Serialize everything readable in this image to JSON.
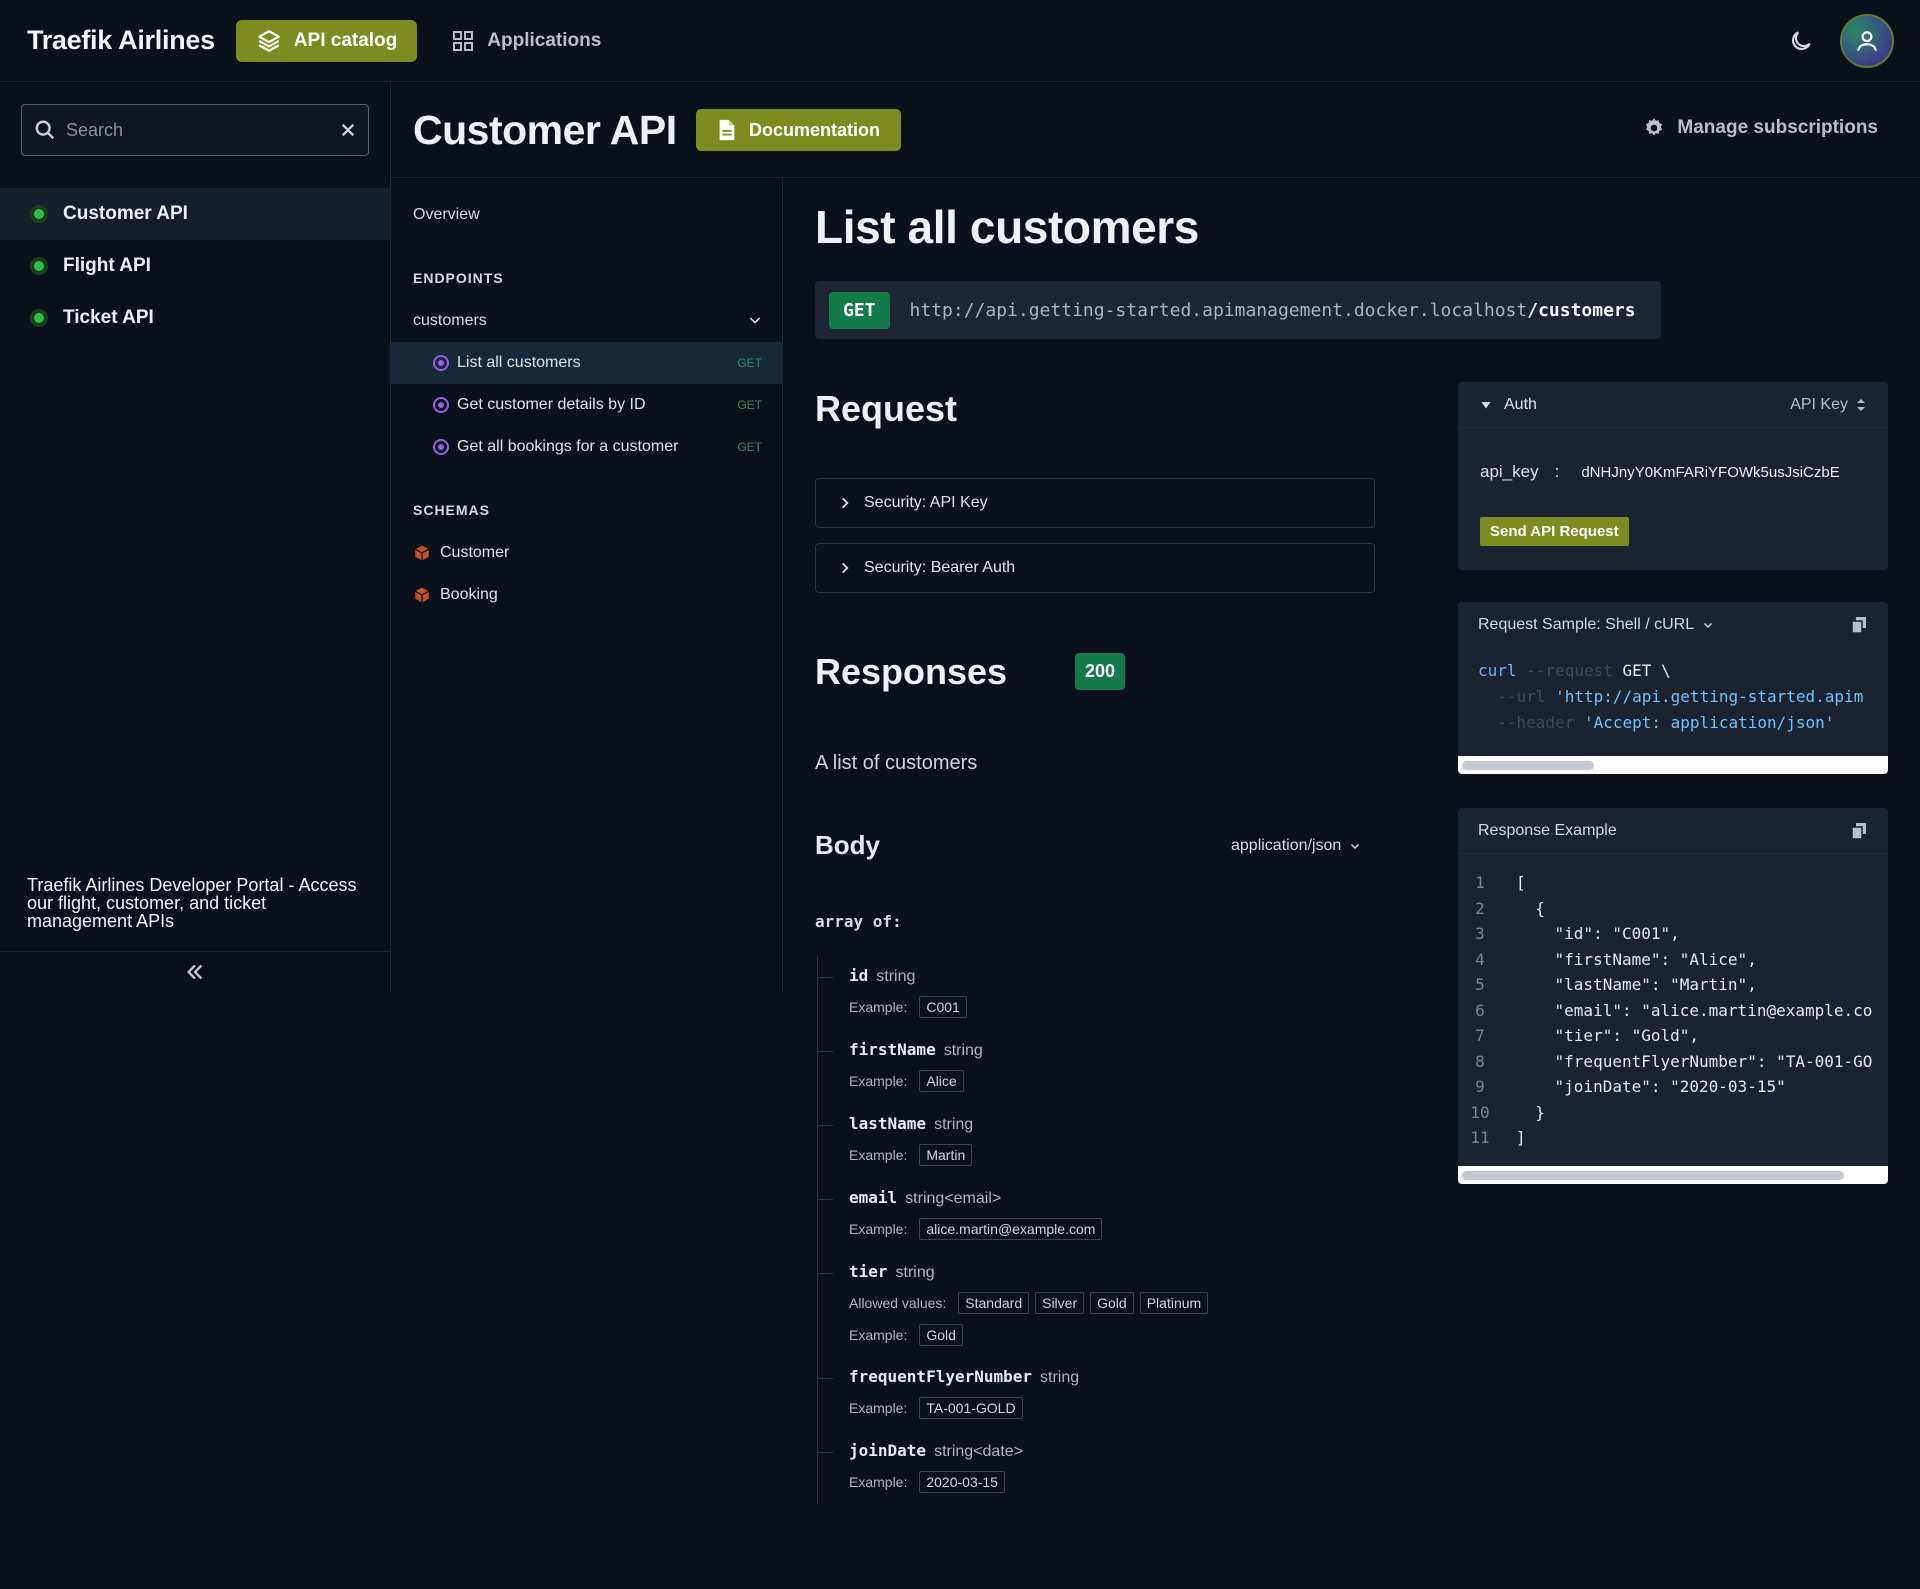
{
  "topbar": {
    "brand": "Traefik Airlines",
    "nav_catalog": "API catalog",
    "nav_applications": "Applications"
  },
  "sidebar": {
    "search_placeholder": "Search",
    "apis": [
      {
        "label": "Customer API"
      },
      {
        "label": "Flight API"
      },
      {
        "label": "Ticket API"
      }
    ],
    "description": "Traefik Airlines Developer Portal - Access our flight, customer, and ticket management APIs"
  },
  "header": {
    "title": "Customer API",
    "documentation": "Documentation",
    "manage": "Manage subscriptions"
  },
  "midnav": {
    "overview": "Overview",
    "endpoints_heading": "ENDPOINTS",
    "group": "customers",
    "endpoints": [
      {
        "label": "List all customers",
        "method": "GET"
      },
      {
        "label": "Get customer details by ID",
        "method": "GET"
      },
      {
        "label": "Get all bookings for a customer",
        "method": "GET"
      }
    ],
    "schemas_heading": "SCHEMAS",
    "schemas": [
      {
        "label": "Customer"
      },
      {
        "label": "Booking"
      }
    ]
  },
  "main": {
    "title": "List all customers",
    "method": "GET",
    "url_base": "http://api.getting-started.apimanagement.docker.localhost",
    "url_path": "/customers",
    "request_heading": "Request",
    "security": [
      "Security: API Key",
      "Security: Bearer Auth"
    ],
    "responses_heading": "Responses",
    "status_code": "200",
    "response_desc": "A list of customers",
    "body_heading": "Body",
    "content_type": "application/json",
    "array_of": "array of:",
    "example_label": "Example:",
    "allowed_label": "Allowed values:",
    "fields": [
      {
        "name": "id",
        "type": "string",
        "example": "C001"
      },
      {
        "name": "firstName",
        "type": "string",
        "example": "Alice"
      },
      {
        "name": "lastName",
        "type": "string",
        "example": "Martin"
      },
      {
        "name": "email",
        "type": "string<email>",
        "example": "alice.martin@example.com"
      },
      {
        "name": "tier",
        "type": "string",
        "allowed": [
          "Standard",
          "Silver",
          "Gold",
          "Platinum"
        ],
        "example": "Gold"
      },
      {
        "name": "frequentFlyerNumber",
        "type": "string",
        "example": "TA-001-GOLD"
      },
      {
        "name": "joinDate",
        "type": "string<date>",
        "example": "2020-03-15"
      }
    ]
  },
  "auth": {
    "title": "Auth",
    "type": "API Key",
    "key_label": "api_key",
    "separator": ":",
    "key_value": "dNHJnyY0KmFARiYFOWk5usJsiCzbE",
    "send": "Send API Request"
  },
  "sample": {
    "title": "Request Sample: Shell / cURL",
    "line1_cmd": "curl",
    "line1_flag": " --request",
    "line1_rest": " GET \\",
    "line2_flag": "  --url",
    "line2_str": " 'http://api.getting-started.apim",
    "line3_flag": "  --header",
    "line3_str": " 'Accept: application/json'"
  },
  "response_example": {
    "title": "Response Example",
    "lines": [
      {
        "n": "1",
        "t": "["
      },
      {
        "n": "2",
        "t": "  {"
      },
      {
        "n": "3",
        "t": "    \"id\": \"C001\","
      },
      {
        "n": "4",
        "t": "    \"firstName\": \"Alice\","
      },
      {
        "n": "5",
        "t": "    \"lastName\": \"Martin\","
      },
      {
        "n": "6",
        "t": "    \"email\": \"alice.martin@example.co"
      },
      {
        "n": "7",
        "t": "    \"tier\": \"Gold\","
      },
      {
        "n": "8",
        "t": "    \"frequentFlyerNumber\": \"TA-001-GO"
      },
      {
        "n": "9",
        "t": "    \"joinDate\": \"2020-03-15\""
      },
      {
        "n": "10",
        "t": "  }"
      },
      {
        "n": "11",
        "t": "]"
      }
    ]
  },
  "colors": {
    "accent": "#7d8c20",
    "get_badge": "#137a4a",
    "background": "#0b111a",
    "status_dot": "#2fbf3f"
  }
}
